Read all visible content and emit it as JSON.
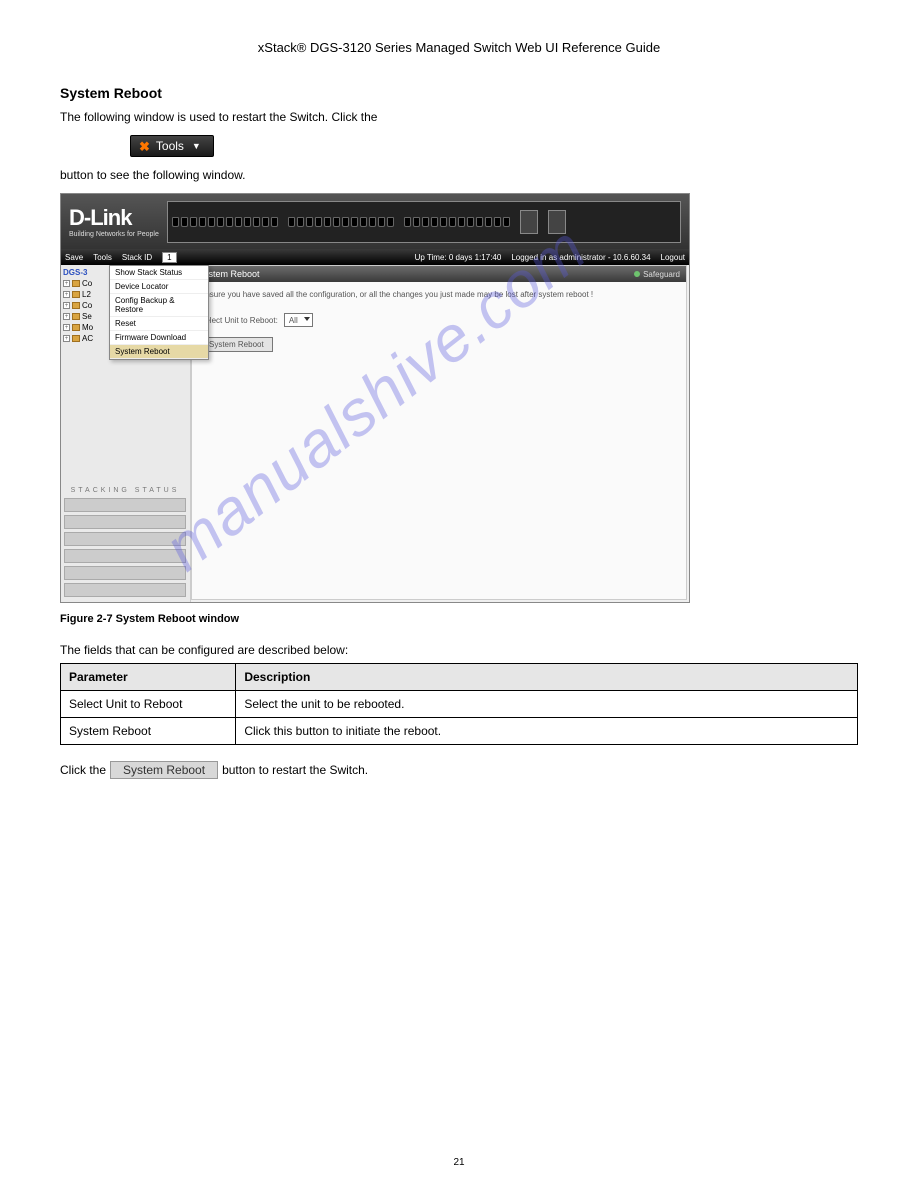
{
  "page": {
    "title": "xStack® DGS-3120 Series Managed Switch Web UI Reference Guide",
    "number": "21"
  },
  "section": {
    "heading": "System Reboot",
    "intro_prefix": "The following window is used to restart the Switch. Click the ",
    "intro_suffix": " button to see the following window."
  },
  "tools_button": {
    "icon_glyph": "✖",
    "label": "Tools",
    "caret": "▼"
  },
  "screenshot": {
    "brand": {
      "name": "D-Link",
      "tagline": "Building Networks for People"
    },
    "menubar": {
      "save": "Save",
      "tools": "Tools",
      "stack_id": "Stack ID",
      "stack_value": "1",
      "uptime": "Up Time: 0 days 1:17:40",
      "logged_in": "Logged in as administrator - 10.6.60.34",
      "logout": "Logout"
    },
    "tree": {
      "root": "DGS-3",
      "items": [
        "Co",
        "L2",
        "Co",
        "Se",
        "Mo",
        "AC"
      ]
    },
    "dropdown": {
      "items": [
        "Show Stack Status",
        "Device Locator",
        "Config Backup & Restore",
        "Reset",
        "Firmware Download",
        "System Reboot"
      ],
      "highlighted_index": 5
    },
    "main_panel": {
      "title": "System Reboot",
      "safeguard": "Safeguard",
      "warning": "Ensure you have saved all the configuration, or all the changes you just made may be lost after system reboot !",
      "select_label": "Select Unit to Reboot:",
      "select_value": "All",
      "button_label": "System Reboot"
    },
    "left_bottom": {
      "heading": "STACKING STATUS"
    }
  },
  "watermark": "manualshive.com",
  "figure_caption": "Figure 2-7 System Reboot window",
  "table": {
    "intro": "The fields that can be configured are described below:",
    "headers": [
      "Parameter",
      "Description"
    ],
    "rows": [
      {
        "p": "Select Unit to Reboot",
        "d": "Select the unit to be rebooted."
      },
      {
        "p": "System Reboot",
        "d": "Click this button to initiate the reboot."
      }
    ]
  },
  "after_table": {
    "prefix": "Click the ",
    "button": "System Reboot",
    "suffix": " button to restart the Switch."
  }
}
